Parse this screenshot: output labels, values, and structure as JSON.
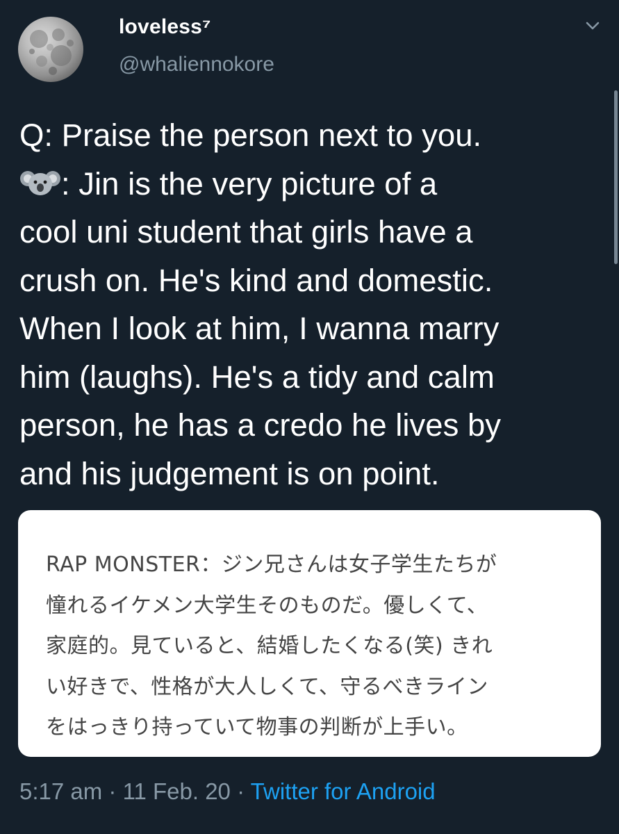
{
  "user": {
    "display_name": "loveless⁷",
    "handle": "@whaliennokore"
  },
  "tweet": {
    "line1": "Q: Praise the person next to you.",
    "emoji": "koala",
    "line2_after_emoji": ": Jin is the very picture of a",
    "line3": "cool uni student that girls have a",
    "line4": "crush on. He's kind and domestic.",
    "line5": "When I look at him, I wanna marry",
    "line6": "him (laughs). He's a tidy and calm",
    "line7": "person, he has a credo he lives by",
    "line8": "and his judgement is on point."
  },
  "quote": {
    "lines": [
      "RAP MONSTER：ジン兄さんは女子学生たちが",
      "憧れるイケメン大学生そのものだ。優しくて、",
      "家庭的。見ていると、結婚したくなる(笑) きれ",
      "い好きで、性格が大人しくて、守るべきライン",
      "をはっきり持っていて物事の判断が上手い。"
    ]
  },
  "meta": {
    "time": "5:17 am",
    "separator": " · ",
    "date": "11 Feb. 20",
    "source": "Twitter for Android"
  },
  "icons": {
    "avatar": "moon-avatar",
    "menu": "chevron-down-icon"
  },
  "colors": {
    "background": "#15202b",
    "secondary_text": "#8899a6",
    "link": "#1da1f2"
  }
}
